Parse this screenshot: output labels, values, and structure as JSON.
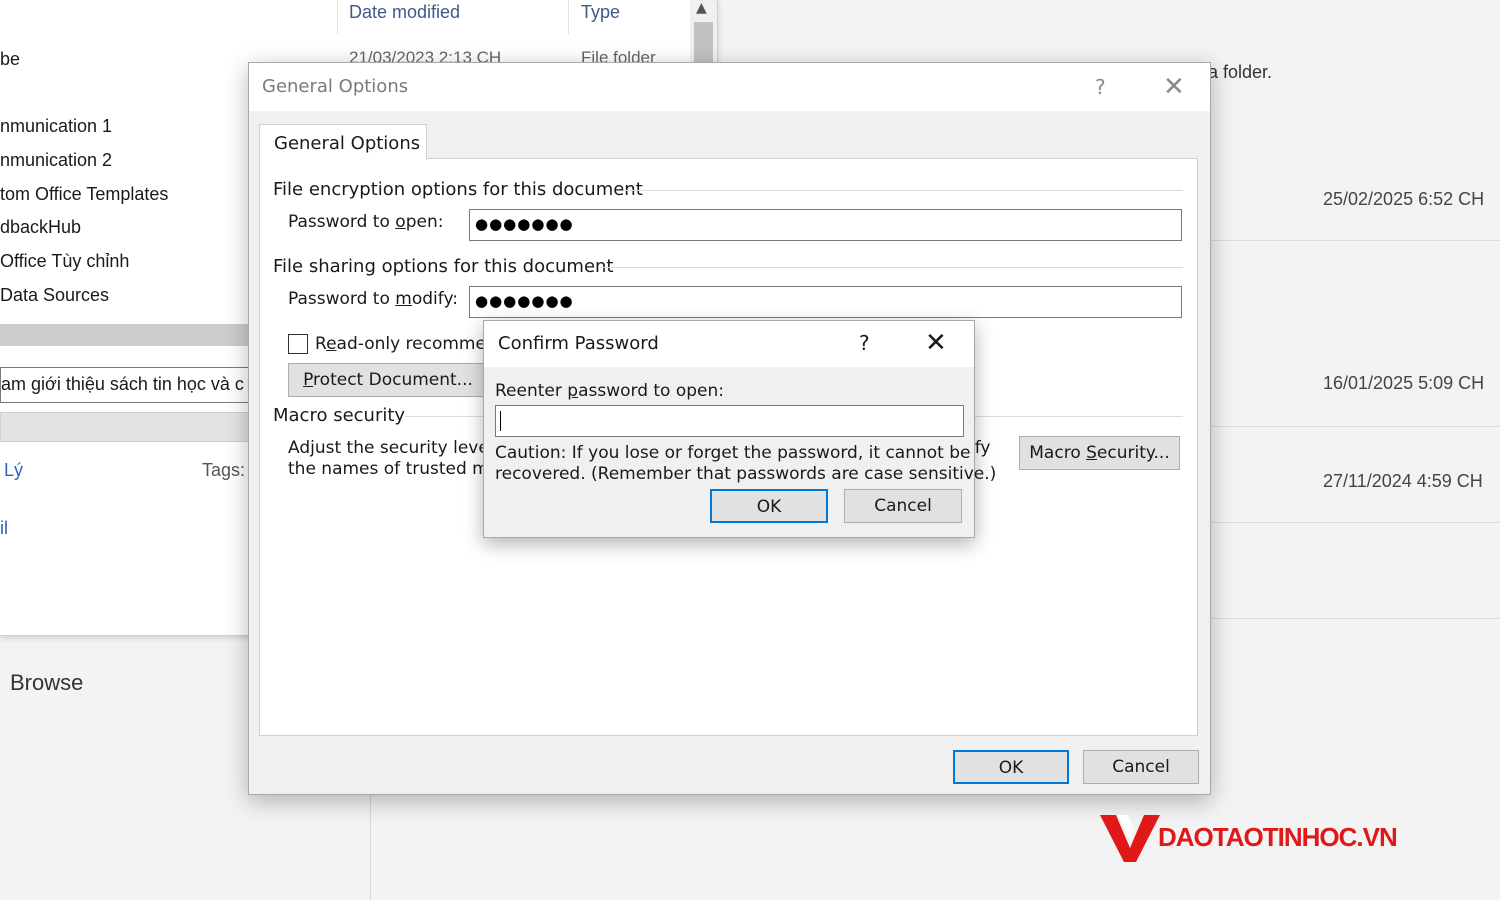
{
  "background": {
    "hint_text": "a folder.",
    "browse_label": "Browse",
    "recent_dates": [
      "25/02/2025 6:52 CH",
      "16/01/2025 5:09 CH",
      "27/11/2024 4:59 CH"
    ]
  },
  "explorer": {
    "columns": {
      "date_modified": "Date modified",
      "type": "Type"
    },
    "top_row": {
      "date": "21/03/2023 2:13 CH",
      "type": "File folder"
    },
    "nav_items": [
      "be",
      "nmunication 1",
      "nmunication 2",
      "tom Office Templates",
      "dbackHub",
      "Office Tùy chỉnh",
      "Data Sources"
    ],
    "file_name": "am giới thiệu sách tin học và c",
    "author_link": "Lý",
    "tags_label": "Tags:",
    "extra_link": "il"
  },
  "general_options": {
    "title": "General Options",
    "help_glyph": "?",
    "close_glyph": "✕",
    "tab_label": "General Options",
    "encryption_group": "File encryption options for this document",
    "password_open_label_pre": "Password to ",
    "password_open_label_u": "o",
    "password_open_label_post": "pen:",
    "password_open_value": "●●●●●●●",
    "sharing_group": "File sharing options for this document",
    "password_modify_label_pre": "Password to ",
    "password_modify_label_u": "m",
    "password_modify_label_post": "odify:",
    "password_modify_value": "●●●●●●●",
    "readonly_pre": "R",
    "readonly_u": "e",
    "readonly_post": "ad-only recommen",
    "protect_pre": "",
    "protect_u": "P",
    "protect_post": "rotect Document...",
    "macro_group": "Macro security",
    "macro_desc_line1": "Adjust the security level",
    "macro_desc_line1_tail": "ify",
    "macro_desc_line2": "the names of trusted ma",
    "macro_btn_pre": "Macro ",
    "macro_btn_u": "S",
    "macro_btn_post": "ecurity...",
    "ok_label": "OK",
    "cancel_label": "Cancel"
  },
  "confirm_password": {
    "title": "Confirm Password",
    "help_glyph": "?",
    "close_glyph": "✕",
    "reenter_pre": "Reenter ",
    "reenter_u": "p",
    "reenter_post": "assword to open:",
    "input_value": "",
    "caution_line1": "Caution: If you lose or forget the password, it cannot be",
    "caution_line2": "recovered. (Remember that passwords are case sensitive.)",
    "ok_label": "OK",
    "cancel_label": "Cancel"
  },
  "watermark": {
    "text": "DAOTAOTINHOC.VN",
    "color": "#e01818"
  }
}
